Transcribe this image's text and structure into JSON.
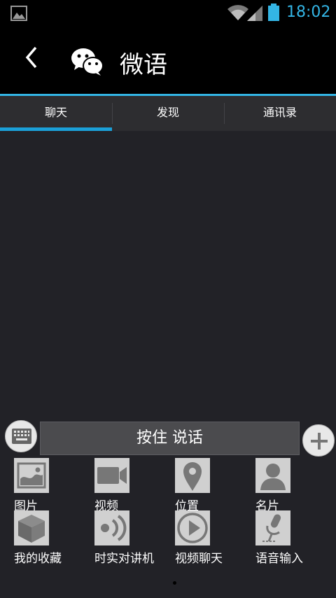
{
  "status_bar": {
    "time": "18:02",
    "accent_color": "#33b5e5",
    "icons": [
      "image-icon",
      "wifi-icon",
      "signal-icon",
      "battery-icon"
    ]
  },
  "action_bar": {
    "title": "微语",
    "icons": [
      "back-icon",
      "wechat-icon"
    ]
  },
  "tabs": [
    {
      "label": "聊天",
      "active": true
    },
    {
      "label": "发现",
      "active": false
    },
    {
      "label": "通讯录",
      "active": false
    }
  ],
  "input": {
    "talk_label": "按住 说话",
    "icons": [
      "keyboard-icon",
      "plus-icon"
    ]
  },
  "grid": {
    "items": [
      {
        "label": "图片",
        "icon": "picture-icon"
      },
      {
        "label": "视频",
        "icon": "video-icon"
      },
      {
        "label": "位置",
        "icon": "location-icon"
      },
      {
        "label": "名片",
        "icon": "contact-card-icon"
      },
      {
        "label": "我的收藏",
        "icon": "favorites-box-icon"
      },
      {
        "label": "时实对讲机",
        "icon": "walkie-talkie-icon"
      },
      {
        "label": "视频聊天",
        "icon": "video-chat-icon"
      },
      {
        "label": "语音输入",
        "icon": "microphone-icon"
      }
    ]
  },
  "pager": {
    "page": 1
  }
}
